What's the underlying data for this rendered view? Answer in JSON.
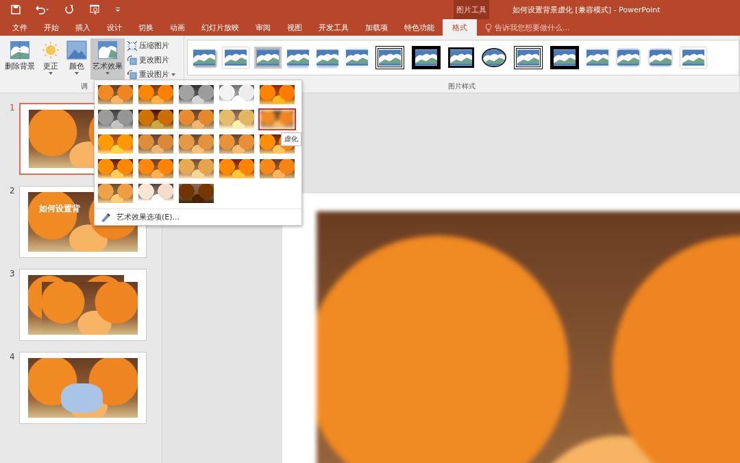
{
  "title_bar": {
    "context_tab": "图片工具",
    "title": "如何设置背景虚化 [兼容模式] - PowerPoint"
  },
  "tabs": [
    {
      "label": "文件",
      "selected": false
    },
    {
      "label": "开始",
      "selected": false
    },
    {
      "label": "插入",
      "selected": false
    },
    {
      "label": "设计",
      "selected": false
    },
    {
      "label": "切换",
      "selected": false
    },
    {
      "label": "动画",
      "selected": false
    },
    {
      "label": "幻灯片放映",
      "selected": false
    },
    {
      "label": "审阅",
      "selected": false
    },
    {
      "label": "视图",
      "selected": false
    },
    {
      "label": "开发工具",
      "selected": false
    },
    {
      "label": "加载项",
      "selected": false
    },
    {
      "label": "特色功能",
      "selected": false
    },
    {
      "label": "格式",
      "selected": true
    }
  ],
  "search": {
    "placeholder": "告诉我您想要做什么..."
  },
  "adjust_group": {
    "label": "调",
    "large_buttons": [
      {
        "kind": "remove-background",
        "label": "删除背景",
        "dropdown": false,
        "selected": false
      },
      {
        "kind": "corrections",
        "label": "更正",
        "dropdown": true,
        "selected": false
      },
      {
        "kind": "color",
        "label": "颜色",
        "dropdown": true,
        "selected": false
      },
      {
        "kind": "artistic",
        "label": "艺术效果",
        "dropdown": true,
        "selected": true
      }
    ],
    "small_buttons": [
      {
        "kind": "compress",
        "label": "压缩图片",
        "dropdown": false
      },
      {
        "kind": "change",
        "label": "更改图片",
        "dropdown": false
      },
      {
        "kind": "reset",
        "label": "重设图片",
        "dropdown": true
      }
    ]
  },
  "styles_group": {
    "label": "图片样式",
    "items": [
      {
        "kind": "shadow",
        "selected": false
      },
      {
        "kind": "white-frame",
        "selected": false
      },
      {
        "kind": "plain",
        "selected": true
      },
      {
        "kind": "reflect",
        "selected": false
      },
      {
        "kind": "reflect",
        "selected": false
      },
      {
        "kind": "soft",
        "selected": false
      },
      {
        "kind": "double-black",
        "selected": false
      },
      {
        "kind": "thick-black",
        "selected": false
      },
      {
        "kind": "black-frame",
        "selected": false
      },
      {
        "kind": "oval",
        "selected": false
      },
      {
        "kind": "double-black",
        "selected": false
      },
      {
        "kind": "thick-black",
        "selected": false
      },
      {
        "kind": "soft",
        "selected": false
      },
      {
        "kind": "rounded",
        "selected": false
      },
      {
        "kind": "rounded",
        "selected": false
      },
      {
        "kind": "white-frame",
        "selected": false
      }
    ]
  },
  "effects_menu": {
    "items": [
      {
        "kind": "none",
        "selected": false
      },
      {
        "kind": "marker",
        "selected": false
      },
      {
        "kind": "pencil-gray",
        "selected": false
      },
      {
        "kind": "pencil-sketch",
        "selected": false
      },
      {
        "kind": "line",
        "selected": false
      },
      {
        "kind": "chalk",
        "selected": false
      },
      {
        "kind": "paint",
        "selected": false
      },
      {
        "kind": "watercolor",
        "selected": false
      },
      {
        "kind": "light",
        "selected": false
      },
      {
        "kind": "blur",
        "selected": true
      },
      {
        "kind": "mosaic",
        "selected": false
      },
      {
        "kind": "film",
        "selected": false
      },
      {
        "kind": "cement",
        "selected": false
      },
      {
        "kind": "texture",
        "selected": false
      },
      {
        "kind": "crackle",
        "selected": false
      },
      {
        "kind": "cutout",
        "selected": false
      },
      {
        "kind": "glow",
        "selected": false
      },
      {
        "kind": "pastel",
        "selected": false
      },
      {
        "kind": "plastic",
        "selected": false
      },
      {
        "kind": "glass",
        "selected": false
      },
      {
        "kind": "posterize",
        "selected": false
      },
      {
        "kind": "photocopy",
        "selected": false
      },
      {
        "kind": "glow-edges",
        "selected": false
      }
    ],
    "tooltip": "虚化",
    "option": "艺术效果选项(E)..."
  },
  "slides": [
    {
      "number": "1",
      "kind": "photo",
      "selected": true
    },
    {
      "number": "2",
      "kind": "photo-title",
      "title": "如何设置背",
      "selected": false
    },
    {
      "number": "3",
      "kind": "photo-double",
      "selected": false
    },
    {
      "number": "4",
      "kind": "photo-recolor",
      "selected": false
    }
  ]
}
